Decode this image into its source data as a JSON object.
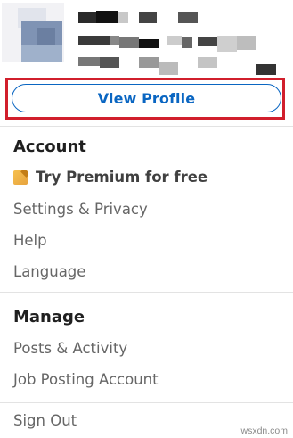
{
  "profile": {
    "view_profile_label": "View Profile"
  },
  "account": {
    "title": "Account",
    "premium_label": "Try Premium for free",
    "items": [
      "Settings & Privacy",
      "Help",
      "Language"
    ]
  },
  "manage": {
    "title": "Manage",
    "items": [
      "Posts & Activity",
      "Job Posting Account"
    ]
  },
  "sign_out_label": "Sign Out",
  "watermark": "wsxdn.com",
  "colors": {
    "accent": "#0a66c2",
    "highlight": "#d11f2c",
    "premium": "#e7a33e"
  }
}
